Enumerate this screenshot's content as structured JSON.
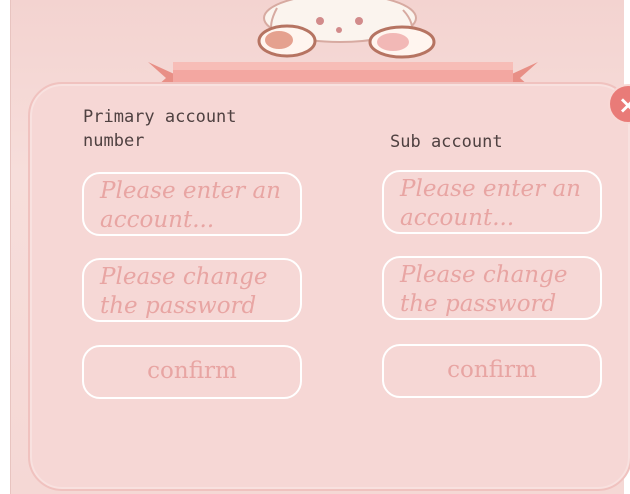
{
  "primary": {
    "title": "Primary account number",
    "account_placeholder": "Please enter an account...",
    "password_placeholder": "Please change the password",
    "confirm_label": "confirm"
  },
  "sub": {
    "title": "Sub account",
    "account_placeholder": "Please enter an account...",
    "password_placeholder": "Please change the password",
    "confirm_label": "confirm"
  },
  "close": {
    "icon": "close-icon",
    "glyph": "×"
  },
  "colors": {
    "background": "#f6d7d5",
    "ribbon": "#f3a7a1",
    "text": "#4f4141",
    "placeholder": "#e8a5a3",
    "close": "#e97b78"
  }
}
